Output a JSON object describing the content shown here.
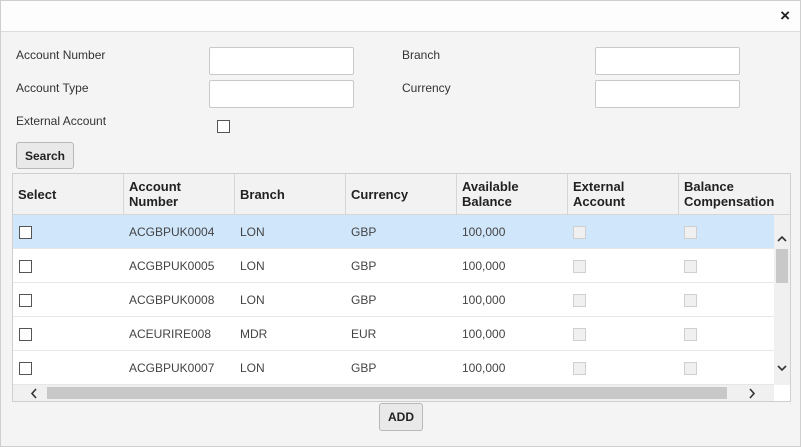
{
  "dialog": {
    "close_glyph": "×"
  },
  "form": {
    "account_number_label": "Account Number",
    "account_number_value": "",
    "branch_label": "Branch",
    "branch_value": "",
    "account_type_label": "Account Type",
    "account_type_value": "",
    "currency_label": "Currency",
    "currency_value": "",
    "external_account_label": "External Account",
    "external_account_checked": false,
    "search_button": "Search"
  },
  "table": {
    "columns": [
      "Select",
      "Account\nNumber",
      "Branch",
      "Currency",
      "Available\nBalance",
      "External\nAccount",
      "Balance\nCompensation"
    ],
    "rows": [
      {
        "account_number": "ACGBPUK0004",
        "branch": "LON",
        "currency": "GBP",
        "available_balance": "100,000"
      },
      {
        "account_number": "ACGBPUK0005",
        "branch": "LON",
        "currency": "GBP",
        "available_balance": "100,000"
      },
      {
        "account_number": "ACGBPUK0008",
        "branch": "LON",
        "currency": "GBP",
        "available_balance": "100,000"
      },
      {
        "account_number": "ACEURIRE008",
        "branch": "MDR",
        "currency": "EUR",
        "available_balance": "100,000"
      },
      {
        "account_number": "ACGBPUK0007",
        "branch": "LON",
        "currency": "GBP",
        "available_balance": "100,000"
      }
    ],
    "selected_row_index": 0
  },
  "footer": {
    "add_button": "ADD"
  }
}
